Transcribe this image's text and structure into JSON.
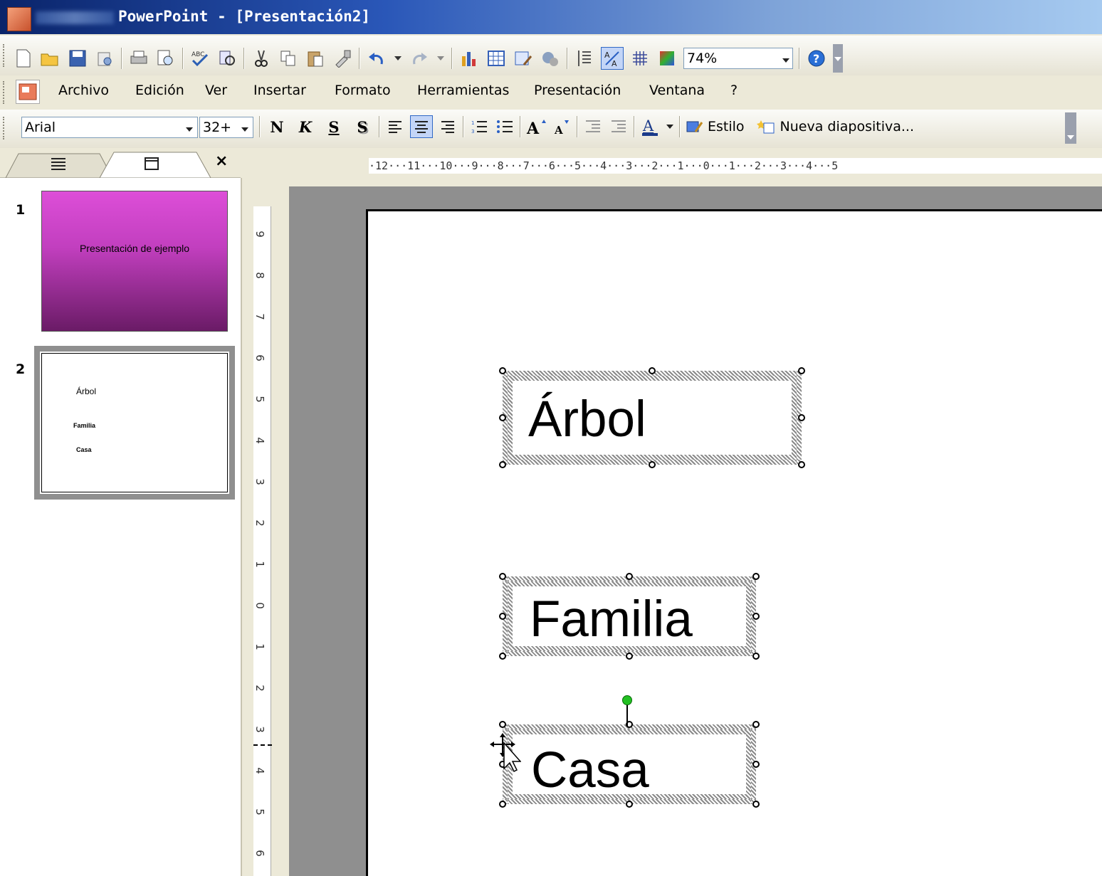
{
  "window": {
    "title": "PowerPoint - [Presentación2]"
  },
  "menu": {
    "items": [
      "Archivo",
      "Edición",
      "Ver",
      "Insertar",
      "Formato",
      "Herramientas",
      "Presentación",
      "Ventana",
      "?"
    ]
  },
  "standard_toolbar": {
    "zoom": "74%",
    "icons": [
      "new-icon",
      "open-icon",
      "save-icon",
      "permission-icon",
      "print-icon",
      "print-preview-icon",
      "spelling-icon",
      "research-icon",
      "cut-icon",
      "copy-icon",
      "paste-icon",
      "format-painter-icon",
      "undo-icon",
      "redo-icon",
      "insert-chart-icon",
      "insert-table-icon",
      "tables-borders-icon",
      "hyperlink-icon",
      "expand-icon",
      "show-formatting-icon",
      "grid-icon",
      "color-grayscale-icon",
      "help-icon"
    ]
  },
  "format_toolbar": {
    "font": "Arial",
    "font_size": "32+",
    "bold": "N",
    "italic": "K",
    "underline": "S",
    "shadow": "S",
    "style_label": "Estilo",
    "new_slide_label": "Nueva diapositiva..."
  },
  "ruler": {
    "horizontal": "·12···11···10···9···8···7···6···5···4···3···2···1···0···1···2···3···4···5",
    "vertical": [
      "9",
      "8",
      "7",
      "6",
      "5",
      "4",
      "3",
      "2",
      "1",
      "0",
      "1",
      "2",
      "3",
      "4",
      "5",
      "6"
    ]
  },
  "slides_pane": {
    "tabs": [
      "outline-tab",
      "slides-tab"
    ],
    "close": "×",
    "thumbnails": [
      {
        "number": "1",
        "text": "Presentación de ejemplo",
        "bg": "#c23fbf"
      },
      {
        "number": "2",
        "items": [
          "Árbol",
          "Familia",
          "Casa"
        ]
      }
    ]
  },
  "slide": {
    "textboxes": [
      "Árbol",
      "Familia",
      "Casa"
    ]
  },
  "colors": {
    "title_bar": "#0a246a",
    "thumb1_top": "#dd4ed8",
    "thumb1_bottom": "#6a1b66",
    "rotation_handle": "#22c022"
  }
}
